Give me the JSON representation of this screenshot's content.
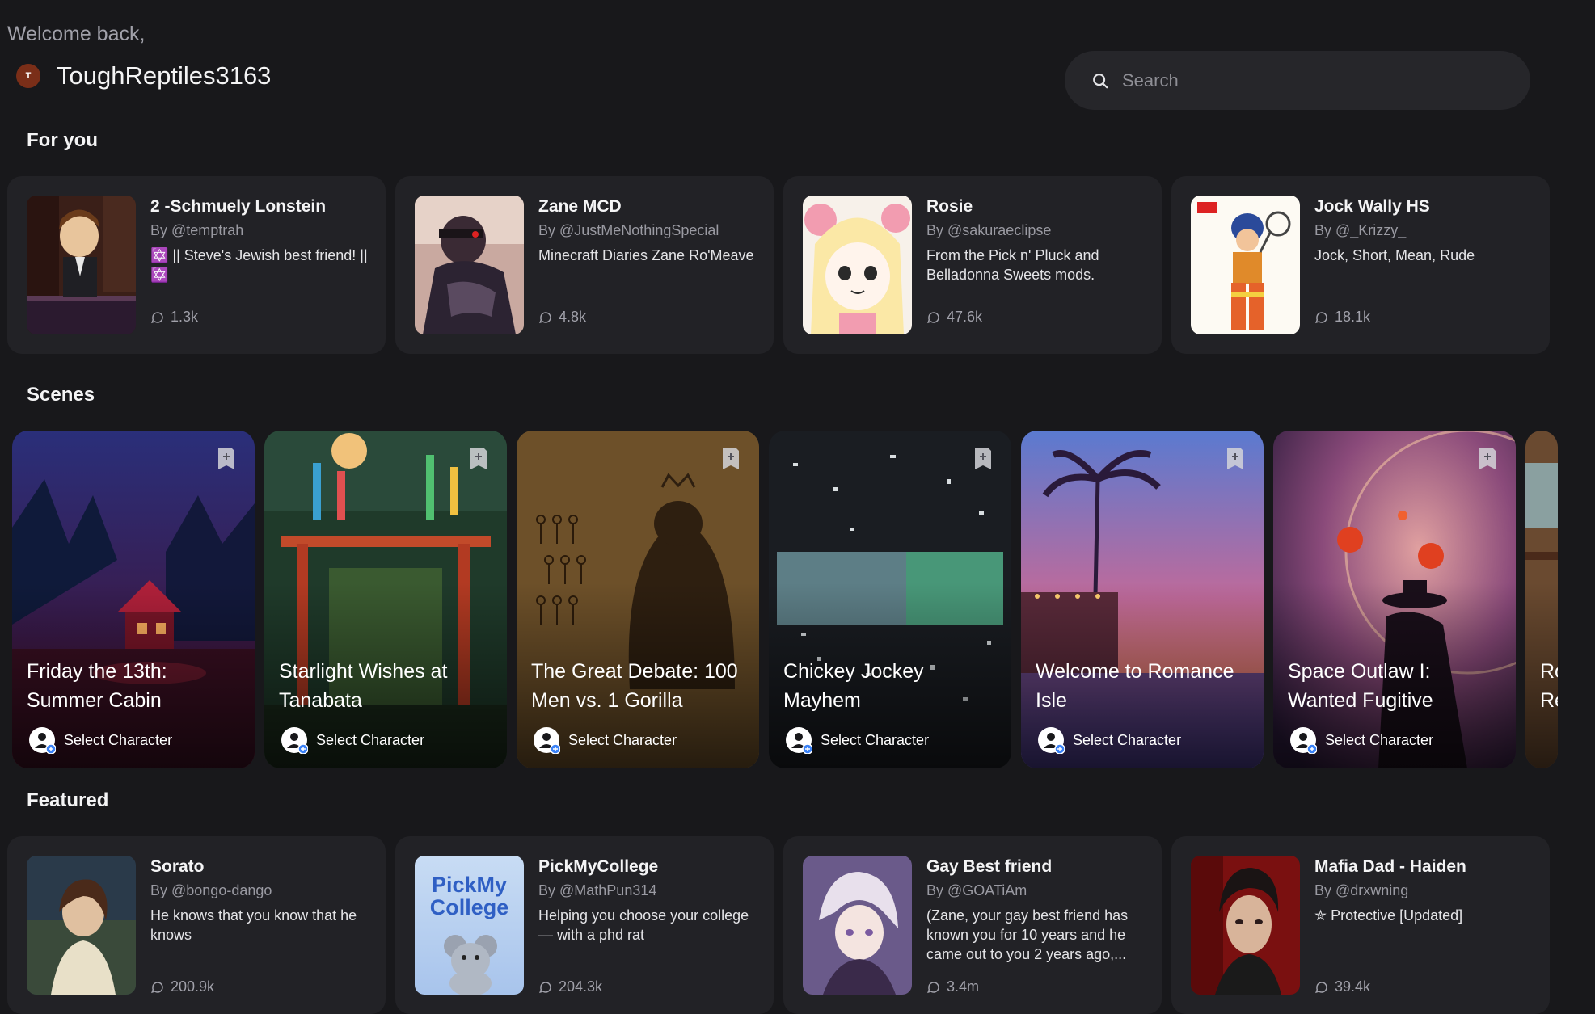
{
  "header": {
    "welcome": "Welcome back,",
    "avatar_letter": "T",
    "username": "ToughReptiles3163",
    "search_placeholder": "Search"
  },
  "sections": {
    "for_you": "For you",
    "scenes": "Scenes",
    "featured": "Featured"
  },
  "for_you": [
    {
      "name": "2 -Schmuely Lonstein",
      "author": "By @temptrah",
      "desc": "✡️ || Steve's Jewish best friend! || ✡️",
      "stat": "1.3k"
    },
    {
      "name": "Zane MCD",
      "author": "By @JustMeNothingSpecial",
      "desc": "Minecraft Diaries Zane Ro'Meave",
      "stat": "4.8k"
    },
    {
      "name": "Rosie",
      "author": "By @sakuraeclipse",
      "desc": "From the Pick n' Pluck and Belladonna Sweets mods.",
      "stat": "47.6k"
    },
    {
      "name": "Jock Wally HS",
      "author": "By @_Krizzy_",
      "desc": "Jock, Short, Mean, Rude",
      "stat": "18.1k"
    }
  ],
  "scenes": [
    {
      "title": "Friday the 13th: Summer Cabin",
      "action": "Select Character"
    },
    {
      "title": "Starlight Wishes at Tanabata",
      "action": "Select Character"
    },
    {
      "title": "The Great Debate: 100 Men vs. 1 Gorilla",
      "action": "Select Character"
    },
    {
      "title": "Chickey Jockey Mayhem",
      "action": "Select Character"
    },
    {
      "title": "Welcome to Romance Isle",
      "action": "Select Character"
    },
    {
      "title": "Space Outlaw I: Wanted Fugitive",
      "action": "Select Character"
    },
    {
      "title": "Ro Re",
      "action": ""
    }
  ],
  "featured": [
    {
      "name": "Sorato",
      "author": "By @bongo-dango",
      "desc": "He knows that you know that he knows",
      "stat": "200.9k"
    },
    {
      "name": "PickMyCollege",
      "author": "By @MathPun314",
      "desc": "Helping you choose your college — with a phd rat",
      "stat": "204.3k",
      "logo_text": "PickMy College"
    },
    {
      "name": "Gay Best friend",
      "author": "By @GOATiAm",
      "desc": "(Zane, your gay best friend has known you for 10 years and he came out to you 2 years ago,...",
      "stat": "3.4m"
    },
    {
      "name": "Mafia Dad - Haiden",
      "author": "By @drxwning",
      "desc": "✮ Protective [Updated]",
      "stat": "39.4k"
    }
  ],
  "colors": {
    "background": "#18181b",
    "card": "#222226",
    "search": "#26262a",
    "muted_text": "#9a9aa2"
  }
}
